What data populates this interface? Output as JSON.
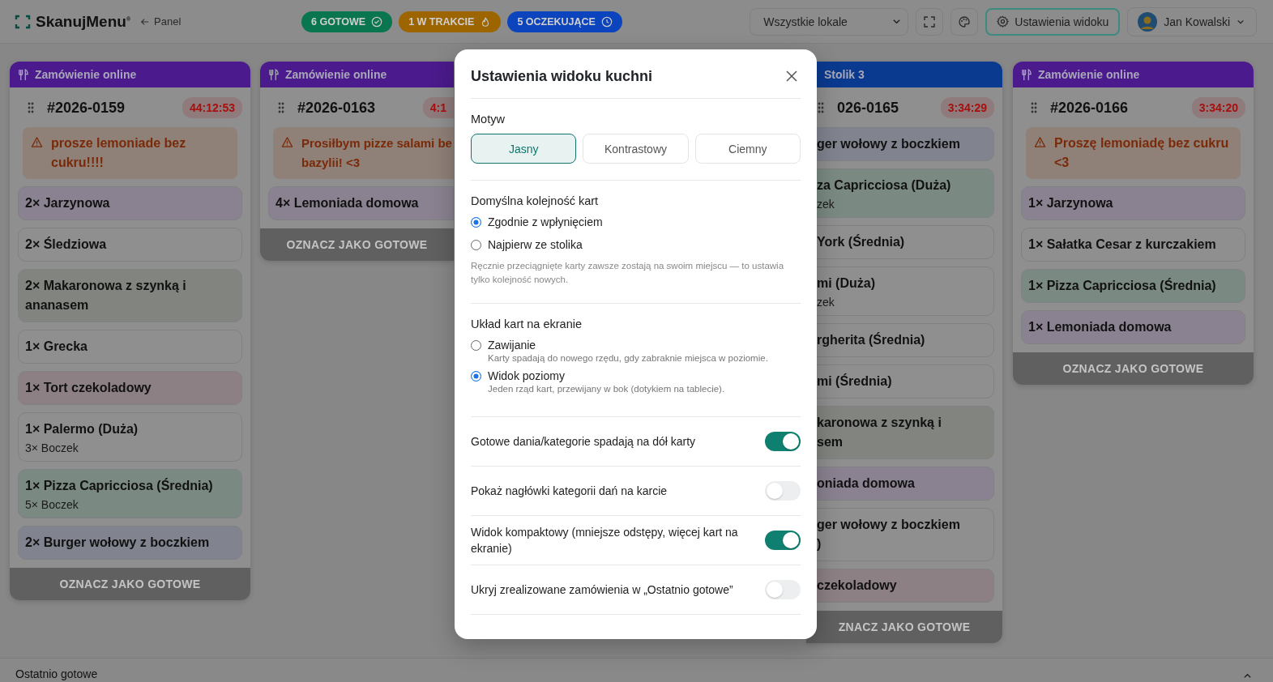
{
  "header": {
    "logo": "SkanujMenu$^{®}$",
    "back": "Panel",
    "badges": [
      {
        "label": "6 GOTOWE",
        "kind": "ready",
        "color": "#0a7650"
      },
      {
        "label": "1 W TRAKCIE",
        "kind": "progress",
        "color": "#9c6500"
      },
      {
        "label": "5 OCZEKUJĄCE",
        "kind": "waiting",
        "color": "#0b44bd"
      }
    ],
    "location_select": "Wszystkie lokale",
    "settings_button": "Ustawienia widoku",
    "user": "Jan Kowalski"
  },
  "columns": [
    {
      "kind": "online",
      "source": "Zamówienie online",
      "order": "#2026-0159",
      "timer": "44:12:53",
      "note": "prosze lemoniade bez cukru!!!!",
      "action": "OZNACZ JAKO GOTOWE",
      "items": [
        {
          "name": "2× Jarzynowa",
          "color": "#8a8290"
        },
        {
          "name": "2× Śledziowa",
          "color": "#8f8f8f"
        },
        {
          "name": "2× Makaronowa z szynką i ananasem",
          "color": "#82857f"
        },
        {
          "name": "1× Grecka",
          "color": "#8f8f8f"
        },
        {
          "name": "1× Tort czekoladowy",
          "color": "#8c8084"
        },
        {
          "name": "1× Palermo (Duża)",
          "extra": "3× Boczek",
          "color": "#8f8f8f"
        },
        {
          "name": "1× Pizza Capricciosa (Średnia)",
          "extra": "5× Boczek",
          "color": "#7a8a82"
        },
        {
          "name": "2× Burger wołowy z boczkiem",
          "color": "#81848f"
        }
      ]
    },
    {
      "kind": "online",
      "source": "Zamówienie online",
      "order": "#2026-0163",
      "timer": "4:1",
      "note": "Prosiłbym pizze salami be\nbazylii! <3",
      "action": "OZNACZ JAKO GOTOWE",
      "items": [
        {
          "name": "4× Lemoniada domowa",
          "color": "#8a8290"
        }
      ]
    },
    {
      "kind": "table",
      "source": "Stolik 3",
      "order": "026-0165",
      "timer": "3:34:29",
      "action": "ZNACZ JAKO GOTOWE",
      "items": [
        {
          "name": "ger wołowy z boczkiem",
          "color": "#81848f"
        },
        {
          "name": "za Capricciosa (Duża)",
          "extra": "zek",
          "color": "#7a8a82"
        },
        {
          "name": "York (Średnia)",
          "color": "#8f8f8f"
        },
        {
          "name": "mi (Duża)",
          "extra": "zek",
          "color": "#8f8f8f"
        },
        {
          "name": "rgherita (Średnia)",
          "color": "#8f8f8f"
        },
        {
          "name": "mi (Średnia)",
          "color": "#8f8f8f"
        },
        {
          "name": "karonowa z szynką i\nsem",
          "color": "#82857f"
        },
        {
          "name": "oniada domowa",
          "color": "#8a8290"
        },
        {
          "name": "ger wołowy z boczkiem\n)",
          "color": "#8f8f8f"
        },
        {
          "name": "czekoladowy",
          "color": "#8c8084"
        }
      ]
    },
    {
      "kind": "online",
      "source": "Zamówienie online",
      "order": "#2026-0166",
      "timer": "3:34:20",
      "note": "Proszę lemoniadę bez cukru <3",
      "action": "OZNACZ JAKO GOTOWE",
      "items": [
        {
          "name": "1× Jarzynowa",
          "color": "#8a8290"
        },
        {
          "name": "1× Sałatka Cesar z kurczakiem",
          "color": "#8f8f8f"
        },
        {
          "name": "1× Pizza Capricciosa (Średnia)",
          "color": "#7a8a82"
        },
        {
          "name": "1× Lemoniada domowa",
          "color": "#8a8290"
        }
      ]
    }
  ],
  "recent": {
    "title": "Ostatnio gotowe"
  },
  "settings": {
    "title": "Ustawienia widoku kuchni",
    "theme": {
      "label": "Motyw",
      "options": [
        {
          "label": "Jasny",
          "selected": true
        },
        {
          "label": "Kontrastowy",
          "selected": false
        },
        {
          "label": "Ciemny",
          "selected": false
        }
      ]
    },
    "order": {
      "label": "Domyślna kolejność kart",
      "options": [
        {
          "label": "Zgodnie z wpłynięciem",
          "selected": true
        },
        {
          "label": "Najpierw ze stolika",
          "selected": false
        }
      ],
      "note": "Ręcznie przeciągnięte karty zawsze zostają na swoim miejscu — to ustawia tylko kolejność nowych."
    },
    "layout": {
      "label": "Układ kart na ekranie",
      "options": [
        {
          "label": "Zawijanie",
          "description": "Karty spadają do nowego rzędu, gdy zabraknie miejsca w poziomie.",
          "selected": false
        },
        {
          "label": "Widok poziomy",
          "description": "Jeden rząd kart, przewijany w bok (dotykiem na tablecie).",
          "selected": true
        }
      ]
    },
    "toggles": [
      {
        "label": "Gotowe dania/kategorie spadają na dół karty",
        "on": true
      },
      {
        "label": "Pokaż nagłówki kategorii dań na karcie",
        "on": false
      },
      {
        "label": "Widok kompaktowy (mniejsze odstępy, więcej kart na ekranie)",
        "on": true
      },
      {
        "label": "Ukryj zrealizowane zamówienia w „Ostatnio gotowe”",
        "on": false
      }
    ]
  }
}
